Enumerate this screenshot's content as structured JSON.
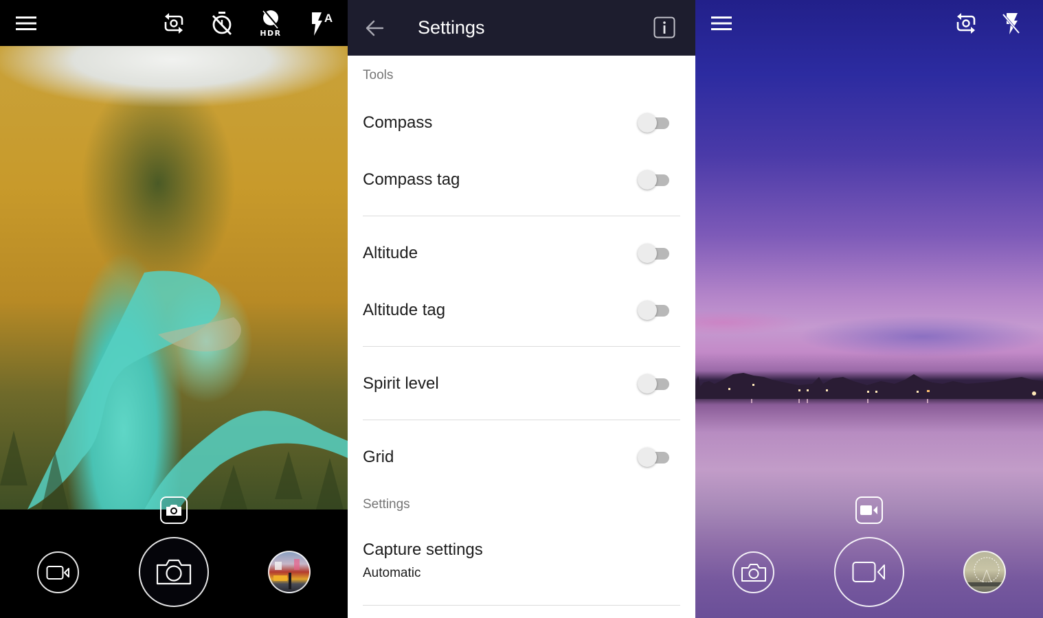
{
  "photo_camera": {
    "toolbar": {
      "menu_icon": "hamburger-menu-icon",
      "switch_camera_icon": "switch-camera-icon",
      "timer_icon": "timer-off-icon",
      "hdr_label": "HDR",
      "hdr_icon": "hdr-off-icon",
      "flash_icon": "flash-auto-icon",
      "flash_auto_label": "A"
    },
    "mode_indicator_icon": "camera-icon",
    "controls": {
      "switch_mode_icon": "video-camera-icon",
      "shutter_icon": "camera-icon",
      "gallery_thumbnail": "gallery-thumbnail-city-street"
    }
  },
  "settings": {
    "title": "Settings",
    "back_icon": "arrow-back-icon",
    "info_icon": "info-icon",
    "sections": [
      {
        "label": "Tools",
        "items": [
          {
            "label": "Compass",
            "enabled": false
          },
          {
            "label": "Compass tag",
            "enabled": false
          },
          {
            "label": "Altitude",
            "enabled": false
          },
          {
            "label": "Altitude tag",
            "enabled": false
          },
          {
            "label": "Spirit level",
            "enabled": false
          },
          {
            "label": "Grid",
            "enabled": false
          }
        ]
      },
      {
        "label": "Settings",
        "items": [
          {
            "label": "Capture settings",
            "value": "Automatic"
          }
        ]
      }
    ]
  },
  "video_camera": {
    "toolbar": {
      "menu_icon": "hamburger-menu-icon",
      "switch_camera_icon": "switch-camera-icon",
      "flash_icon": "flash-off-icon"
    },
    "mode_indicator_icon": "video-camera-icon",
    "controls": {
      "switch_mode_icon": "camera-icon",
      "record_icon": "video-camera-icon",
      "gallery_thumbnail": "gallery-thumbnail-ferris-wheel"
    }
  },
  "colors": {
    "settings_appbar": "#1d1d2e",
    "section_label": "#757575",
    "switch_track_off": "#b8b8b8",
    "switch_knob_off": "#ececec",
    "divider": "#dcdcdc"
  }
}
